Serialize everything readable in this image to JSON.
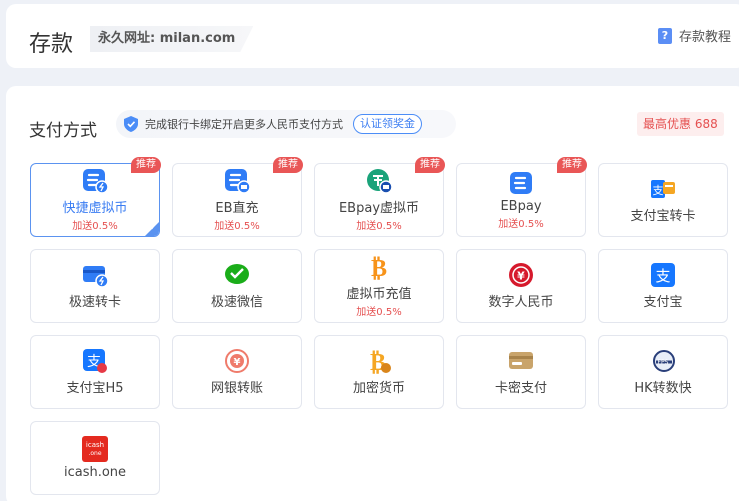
{
  "header": {
    "title": "存款",
    "domain_label": "永久网址: milan.com",
    "tutorial_label": "存款教程"
  },
  "payment": {
    "section_title": "支付方式",
    "notice_text": "完成银行卡绑定开启更多人民币支付方式",
    "verify_label": "认证领奖金",
    "max_discount": "最高优惠 688",
    "methods": [
      {
        "label": "快捷虚拟币",
        "bonus": "加送0.5%",
        "tag": "推荐",
        "icon": "ebpay-fast-icon",
        "selected": true
      },
      {
        "label": "EB直充",
        "bonus": "加送0.5%",
        "tag": "推荐",
        "icon": "eb-direct-icon"
      },
      {
        "label": "EBpay虚拟币",
        "bonus": "加送0.5%",
        "tag": "推荐",
        "icon": "ebpay-crypto-icon"
      },
      {
        "label": "EBpay",
        "bonus": "加送0.5%",
        "tag": "推荐",
        "icon": "ebpay-icon"
      },
      {
        "label": "支付宝转卡",
        "icon": "alipay-to-card-icon"
      },
      {
        "label": "极速转卡",
        "icon": "fast-card-icon"
      },
      {
        "label": "极速微信",
        "icon": "wechat-icon"
      },
      {
        "label": "虚拟币充值",
        "bonus": "加送0.5%",
        "icon": "bitcoin-icon"
      },
      {
        "label": "数字人民币",
        "icon": "digital-rmb-icon"
      },
      {
        "label": "支付宝",
        "icon": "alipay-icon"
      },
      {
        "label": "支付宝H5",
        "icon": "alipay-h5-icon"
      },
      {
        "label": "网银转账",
        "icon": "bank-transfer-icon"
      },
      {
        "label": "加密货币",
        "icon": "crypto-coin-icon"
      },
      {
        "label": "卡密支付",
        "icon": "card-pin-icon"
      },
      {
        "label": "HK转数快",
        "icon": "hk-fps-icon"
      },
      {
        "label": "icash.one",
        "icon": "icash-icon"
      }
    ]
  },
  "colors": {
    "accent": "#3b7df2",
    "bonus_red": "#e55050",
    "tag_red": "#e95656"
  }
}
